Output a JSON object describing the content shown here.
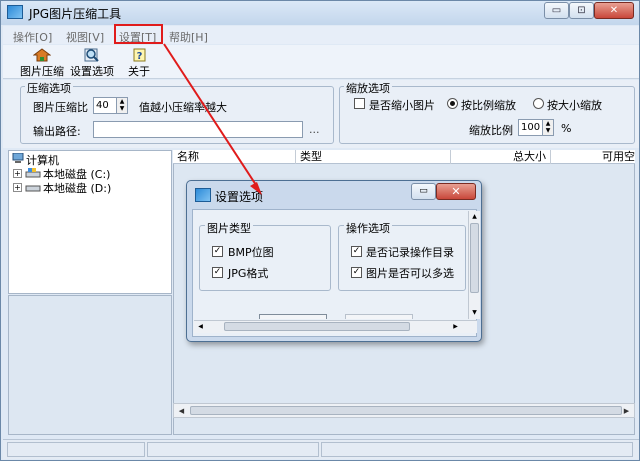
{
  "window": {
    "title": "JPG图片压缩工具",
    "caption_buttons": [
      "▭",
      "⊡",
      "✕"
    ]
  },
  "menu": {
    "items": [
      "操作[O]",
      "视图[V]",
      "设置[T]",
      "帮助[H]"
    ],
    "highlighted_index": 2,
    "highlight_color": "#e01b1b"
  },
  "toolbar": {
    "buttons": [
      {
        "label": "图片压缩",
        "icon": "compress-icon"
      },
      {
        "label": "设置选项",
        "icon": "settings-magnifier-icon"
      },
      {
        "label": "关于",
        "icon": "help-icon"
      }
    ]
  },
  "compress_options": {
    "group_title": "压缩选项",
    "ratio_label": "图片压缩比",
    "ratio_value": "40",
    "ratio_hint": "值越小压缩率越大",
    "output_label": "输出路径:",
    "output_value": "",
    "browse_label": "..."
  },
  "scale_options": {
    "group_title": "缩放选项",
    "shrink_label": "是否缩小图片",
    "shrink_checked": false,
    "by_ratio_label": "按比例缩放",
    "by_ratio_selected": true,
    "by_size_label": "按大小缩放",
    "by_size_selected": false,
    "scale_label": "缩放比例",
    "scale_value": "100",
    "scale_unit": "%"
  },
  "tree": {
    "root": "计算机",
    "drives": [
      "本地磁盘 (C:)",
      "本地磁盘 (D:)"
    ]
  },
  "list": {
    "columns": [
      "名称",
      "类型",
      "总大小",
      "可用空"
    ]
  },
  "dialog": {
    "title": "设置选项",
    "close_label": "✕",
    "image_types": {
      "group_title": "图片类型",
      "items": [
        {
          "label": "BMP位图",
          "checked": true
        },
        {
          "label": "JPG格式",
          "checked": true
        }
      ]
    },
    "operation_options": {
      "group_title": "操作选项",
      "items": [
        {
          "label": "是否记录操作目录",
          "checked": true
        },
        {
          "label": "图片是否可以多选",
          "checked": true
        }
      ]
    }
  },
  "colors": {
    "annotation_red": "#e01b1b",
    "window_bg": "#dfe9f5",
    "panel_bg": "#dde7f2"
  }
}
